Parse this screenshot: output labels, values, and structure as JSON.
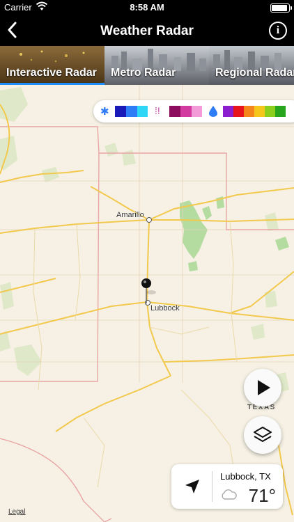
{
  "status_bar": {
    "carrier": "Carrier",
    "time": "8:58 AM",
    "battery_level": 1.0
  },
  "nav": {
    "title": "Weather Radar",
    "back_icon": "chevron-left-icon",
    "info_icon": "info-icon"
  },
  "tabs": [
    {
      "label": "Interactive Radar",
      "selected": true
    },
    {
      "label": "Metro Radar",
      "selected": false
    },
    {
      "label": "Regional Radar",
      "selected": false
    }
  ],
  "legend": {
    "snow_colors": [
      "#1a1ab8",
      "#2e7cf6",
      "#2fd6f5"
    ],
    "mix_colors": [
      "#8e0c5e",
      "#d23aa0",
      "#f29bd8"
    ],
    "rain_colors": [
      "#8b1fd0",
      "#e8141c",
      "#f4861b",
      "#f5c71c",
      "#8ccf1d",
      "#26a51d"
    ]
  },
  "map": {
    "cities": {
      "amarillo": "Amarillo",
      "lubbock": "Lubbock"
    },
    "state_label": "TEXAS",
    "legal": "Legal"
  },
  "controls": {
    "play_icon": "play-icon",
    "layers_icon": "layers-icon"
  },
  "current": {
    "location": "Lubbock, TX",
    "temperature": "71°",
    "condition_icon": "cloud-icon",
    "locate_icon": "location-arrow-icon"
  }
}
